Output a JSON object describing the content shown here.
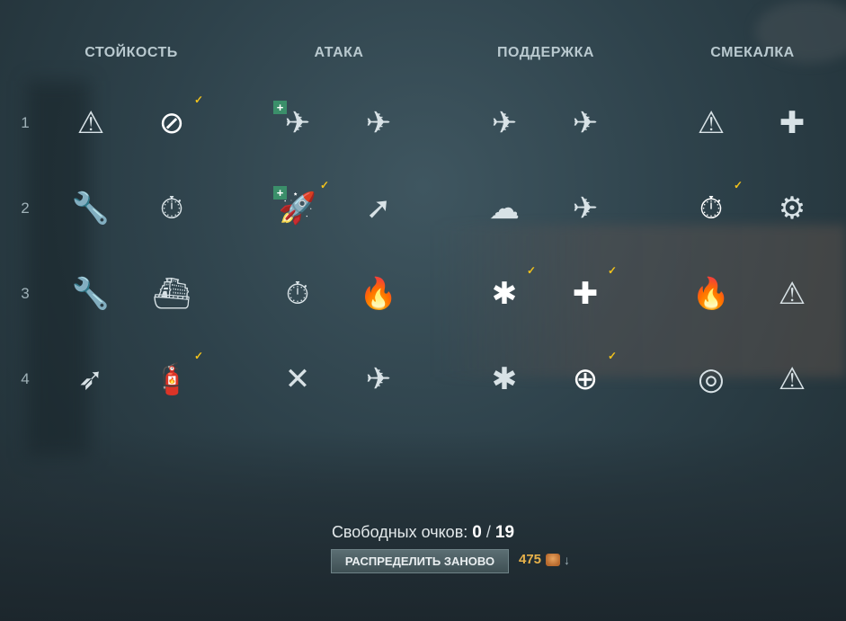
{
  "columns": [
    {
      "title": "СТОЙКОСТЬ"
    },
    {
      "title": "АТАКА"
    },
    {
      "title": "ПОДДЕРЖКА"
    },
    {
      "title": "СМЕКАЛКА"
    }
  ],
  "rows": [
    "1",
    "2",
    "3",
    "4"
  ],
  "skills": {
    "c0": [
      {
        "icon": "warning-target-icon",
        "glyph": "⚠",
        "checked": false
      },
      {
        "icon": "no-fire-icon",
        "glyph": "⊘",
        "checked": true,
        "active": true
      },
      {
        "icon": "wrench-timer-icon",
        "glyph": "🔧",
        "checked": false
      },
      {
        "icon": "stopwatch-icon",
        "glyph": "⏱",
        "checked": false
      },
      {
        "icon": "wrench-upgrade-icon",
        "glyph": "🔧",
        "checked": false
      },
      {
        "icon": "ship-upgrade-icon",
        "glyph": "⛴",
        "checked": false
      },
      {
        "icon": "torpedo-upgrade-icon",
        "glyph": "➶",
        "checked": false
      },
      {
        "icon": "fire-extinguisher-icon",
        "glyph": "🧯",
        "checked": true
      }
    ],
    "c1": [
      {
        "icon": "shell-timer-icon",
        "glyph": "✈",
        "checked": false,
        "plus": true
      },
      {
        "icon": "plane-timer-icon",
        "glyph": "✈",
        "checked": false
      },
      {
        "icon": "rocket-launcher-icon",
        "glyph": "🚀",
        "checked": true,
        "plus": true
      },
      {
        "icon": "shell-upgrade-icon",
        "glyph": "➚",
        "checked": false
      },
      {
        "icon": "shells-timer-icon",
        "glyph": "⏱",
        "checked": false
      },
      {
        "icon": "plane-fire-icon",
        "glyph": "🔥",
        "checked": false
      },
      {
        "icon": "torpedo-cross-icon",
        "glyph": "✕",
        "checked": false
      },
      {
        "icon": "planes-upgrade-icon",
        "glyph": "✈",
        "checked": false
      }
    ],
    "c2": [
      {
        "icon": "planes-target-icon",
        "glyph": "✈",
        "checked": false
      },
      {
        "icon": "plane-armor-icon",
        "glyph": "✈",
        "checked": false
      },
      {
        "icon": "smoke-upgrade-icon",
        "glyph": "☁",
        "checked": false
      },
      {
        "icon": "plane-target-upgrade-icon",
        "glyph": "✈",
        "checked": false
      },
      {
        "icon": "aa-upgrade-icon",
        "glyph": "✱",
        "checked": true,
        "active": true
      },
      {
        "icon": "aa-heal-icon",
        "glyph": "✚",
        "checked": true,
        "active": true
      },
      {
        "icon": "aa-double-upgrade-icon",
        "glyph": "✱",
        "checked": false
      },
      {
        "icon": "plane-crosshair-icon",
        "glyph": "⊕",
        "checked": true,
        "active": true
      }
    ],
    "c3": [
      {
        "icon": "detection-warning-icon",
        "glyph": "⚠",
        "checked": false
      },
      {
        "icon": "bomb-heal-icon",
        "glyph": "✚",
        "checked": false
      },
      {
        "icon": "ship-timer-icon",
        "glyph": "⏱",
        "checked": true,
        "active": true
      },
      {
        "icon": "gears-wrench-icon",
        "glyph": "⚙",
        "checked": false
      },
      {
        "icon": "fire-detection-icon",
        "glyph": "🔥",
        "checked": false
      },
      {
        "icon": "ship-warning-icon",
        "glyph": "⚠",
        "checked": false
      },
      {
        "icon": "radar-icon",
        "glyph": "◎",
        "checked": false
      },
      {
        "icon": "warning-down-icon",
        "glyph": "⚠",
        "checked": false
      }
    ]
  },
  "footer": {
    "label": "Свободных очков:",
    "points_current": "0",
    "separator": "/",
    "points_total": "19",
    "reset_button": "РАСПРЕДЕЛИТЬ ЗАНОВО",
    "cost": "475",
    "currency_icon": "doubloon-icon",
    "arrow_icon": "down-arrow-icon"
  },
  "colors": {
    "accent_check": "#f2c21b",
    "plus_badge": "#3b8f6a",
    "cost": "#e8b24a"
  }
}
